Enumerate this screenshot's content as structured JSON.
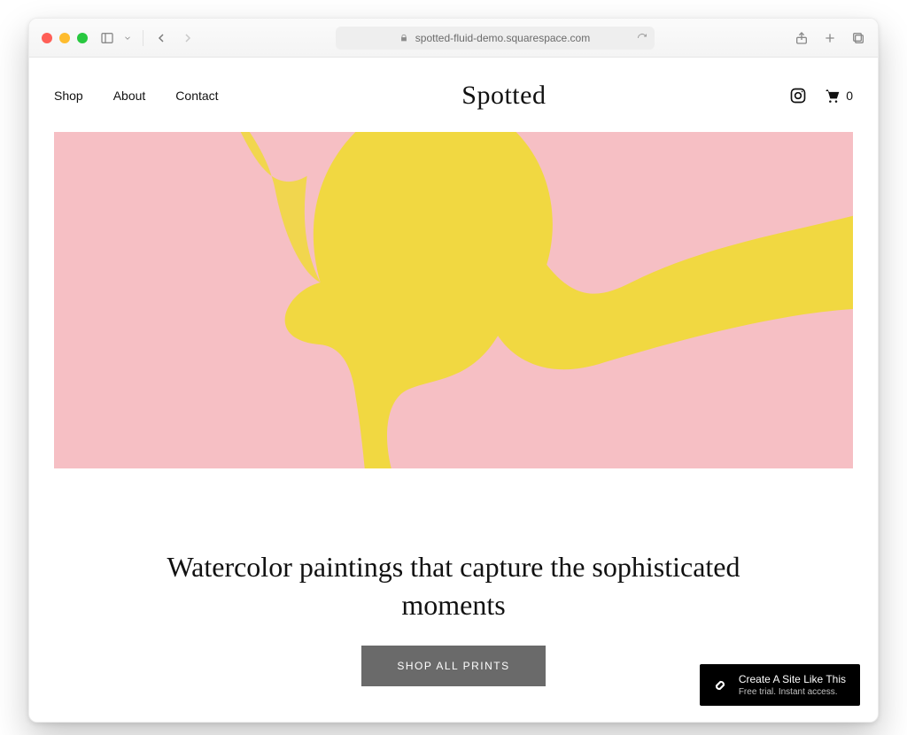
{
  "browser": {
    "url": "spotted-fluid-demo.squarespace.com"
  },
  "header": {
    "nav": {
      "shop": "Shop",
      "about": "About",
      "contact": "Contact"
    },
    "brand": "Spotted",
    "cart_count": "0"
  },
  "hero": {
    "bg_color": "#f6bfc4",
    "accent_color": "#f0d93a"
  },
  "headline": "Watercolor paintings that capture the sophisticated moments",
  "cta_label": "SHOP ALL PRINTS",
  "promo": {
    "title": "Create A Site Like This",
    "subtitle": "Free trial. Instant access."
  }
}
